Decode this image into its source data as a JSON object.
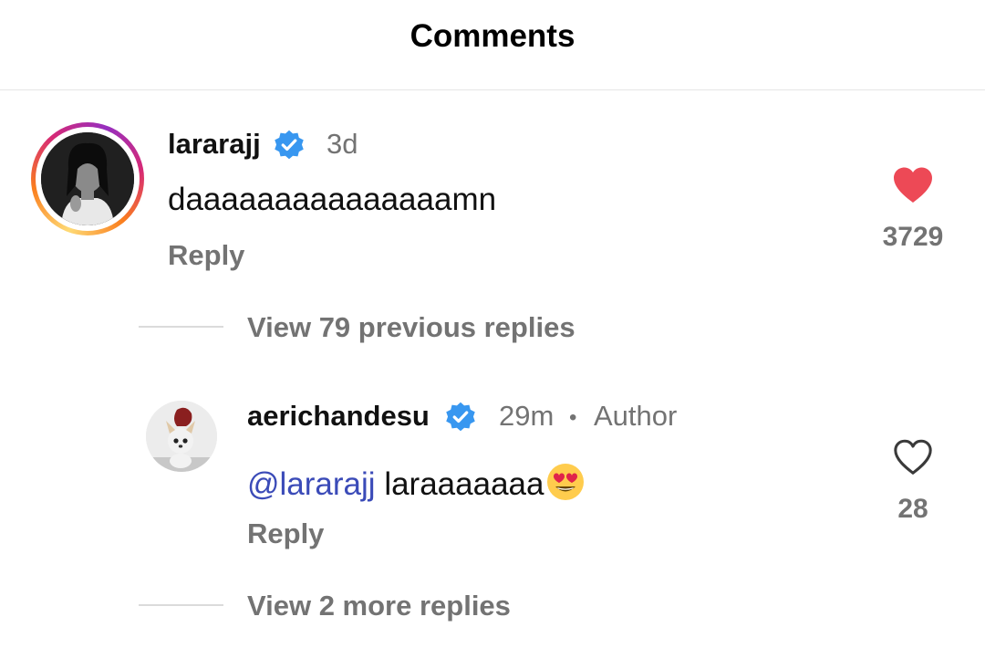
{
  "header": {
    "title": "Comments"
  },
  "comments": [
    {
      "username": "lararajj",
      "verified": true,
      "time": "3d",
      "text": "daaaaaaaaaaaaaaamn",
      "reply_label": "Reply",
      "likes": "3729",
      "liked": true,
      "view_replies_label": "View 79 previous replies"
    }
  ],
  "reply": {
    "username": "aerichandesu",
    "verified": true,
    "time": "29m",
    "separator": "•",
    "author_label": "Author",
    "mention": "@lararajj",
    "text": "laraaaaaaa",
    "emoji": "heart-eyes-emoji",
    "reply_label": "Reply",
    "likes": "28",
    "liked": false,
    "view_more_label": "View 2 more replies"
  },
  "colors": {
    "like_red": "#ed4956",
    "verified_blue": "#3897f0",
    "mention_blue": "#3b4bb8",
    "secondary_text": "#737373"
  }
}
